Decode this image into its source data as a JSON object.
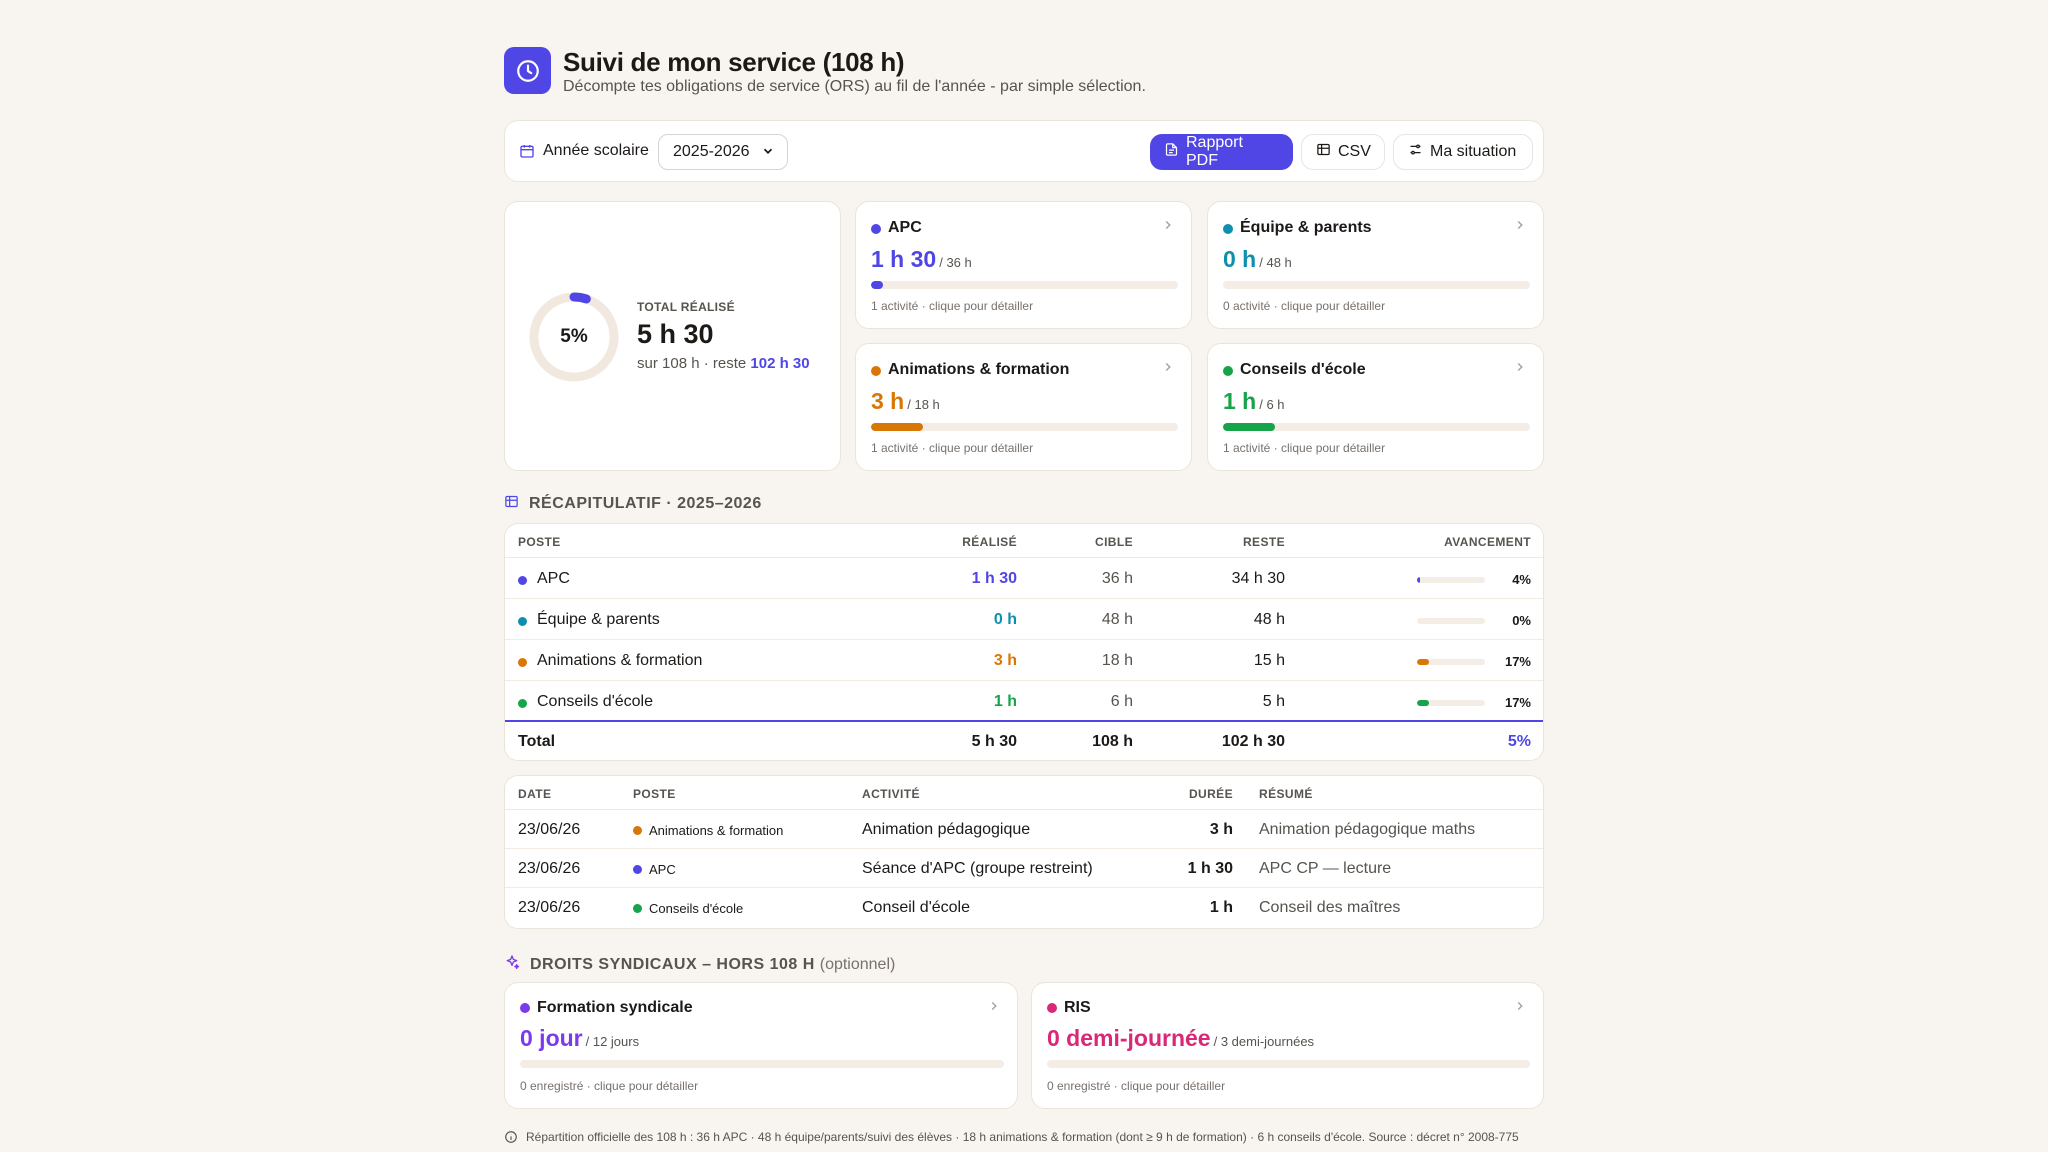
{
  "header": {
    "title": "Suivi de mon service (108 h)",
    "subtitle": "Décompte tes obligations de service (ORS) au fil de l'année - par simple sélection."
  },
  "toolbar": {
    "year_label": "Année scolaire",
    "year_value": "2025-2026",
    "pdf_label": "Rapport PDF",
    "csv_label": "CSV",
    "situation_label": "Ma situation"
  },
  "total": {
    "percent_label": "5%",
    "percent": 5,
    "label": "TOTAL RÉALISÉ",
    "value": "5 h 30",
    "sub_prefix": "sur 108 h · reste",
    "remaining": "102 h 30"
  },
  "categories": [
    {
      "name": "APC",
      "value": "1 h 30",
      "target": "/ 36 h",
      "progress": 4,
      "hint": "1 activité · clique pour détailler",
      "color": "#4f46e5"
    },
    {
      "name": "Équipe & parents",
      "value": "0 h",
      "target": "/ 48 h",
      "progress": 0,
      "hint": "0 activité · clique pour détailler",
      "color": "#0e8fae"
    },
    {
      "name": "Animations & formation",
      "value": "3 h",
      "target": "/ 18 h",
      "progress": 17,
      "hint": "1 activité · clique pour détailler",
      "color": "#d97706"
    },
    {
      "name": "Conseils d'école",
      "value": "1 h",
      "target": "/ 6 h",
      "progress": 17,
      "hint": "1 activité · clique pour détailler",
      "color": "#16a34a"
    }
  ],
  "summary": {
    "title": "RÉCAPITULATIF · 2025–2026",
    "headers": {
      "poste": "POSTE",
      "realise": "RÉALISÉ",
      "cible": "CIBLE",
      "reste": "RESTE",
      "avancement": "AVANCEMENT"
    },
    "rows": [
      {
        "poste": "APC",
        "realise": "1 h 30",
        "cible": "36 h",
        "reste": "34 h 30",
        "pct": "4%",
        "progress": 4
      },
      {
        "poste": "Équipe & parents",
        "realise": "0 h",
        "cible": "48 h",
        "reste": "48 h",
        "pct": "0%",
        "progress": 0
      },
      {
        "poste": "Animations & formation",
        "realise": "3 h",
        "cible": "18 h",
        "reste": "15 h",
        "pct": "17%",
        "progress": 17
      },
      {
        "poste": "Conseils d'école",
        "realise": "1 h",
        "cible": "6 h",
        "reste": "5 h",
        "pct": "17%",
        "progress": 17
      }
    ],
    "total": {
      "label": "Total",
      "realise": "5 h 30",
      "cible": "108 h",
      "reste": "102 h 30",
      "pct": "5%"
    }
  },
  "activities": {
    "headers": {
      "date": "DATE",
      "poste": "POSTE",
      "activite": "ACTIVITÉ",
      "duree": "DURÉE",
      "resume": "RÉSUMÉ"
    },
    "rows": [
      {
        "date": "23/06/26",
        "poste": "Animations & formation",
        "activite": "Animation pédagogique",
        "duree": "3 h",
        "resume": "Animation pédagogique maths",
        "color": "#d97706"
      },
      {
        "date": "23/06/26",
        "poste": "APC",
        "activite": "Séance d'APC (groupe restreint)",
        "duree": "1 h 30",
        "resume": "APC CP — lecture",
        "color": "#4f46e5"
      },
      {
        "date": "23/06/26",
        "poste": "Conseils d'école",
        "activite": "Conseil d'école",
        "duree": "1 h",
        "resume": "Conseil des maîtres",
        "color": "#16a34a"
      }
    ]
  },
  "union": {
    "title": "DROITS SYNDICAUX – HORS 108 H",
    "optional": "(optionnel)",
    "cards": [
      {
        "name": "Formation syndicale",
        "value": "0 jour",
        "target": "/ 12 jours",
        "hint": "0 enregistré · clique pour détailler",
        "color": "#7c3aed"
      },
      {
        "name": "RIS",
        "value": "0 demi-journée",
        "target": "/ 3 demi-journées",
        "hint": "0 enregistré · clique pour détailler",
        "color": "#db2777"
      }
    ]
  },
  "footnote": "Répartition officielle des 108 h : 36 h APC · 48 h équipe/parents/suivi des élèves · 18 h animations & formation (dont ≥ 9 h de formation) · 6 h conseils d'école. Source : décret n° 2008-775"
}
